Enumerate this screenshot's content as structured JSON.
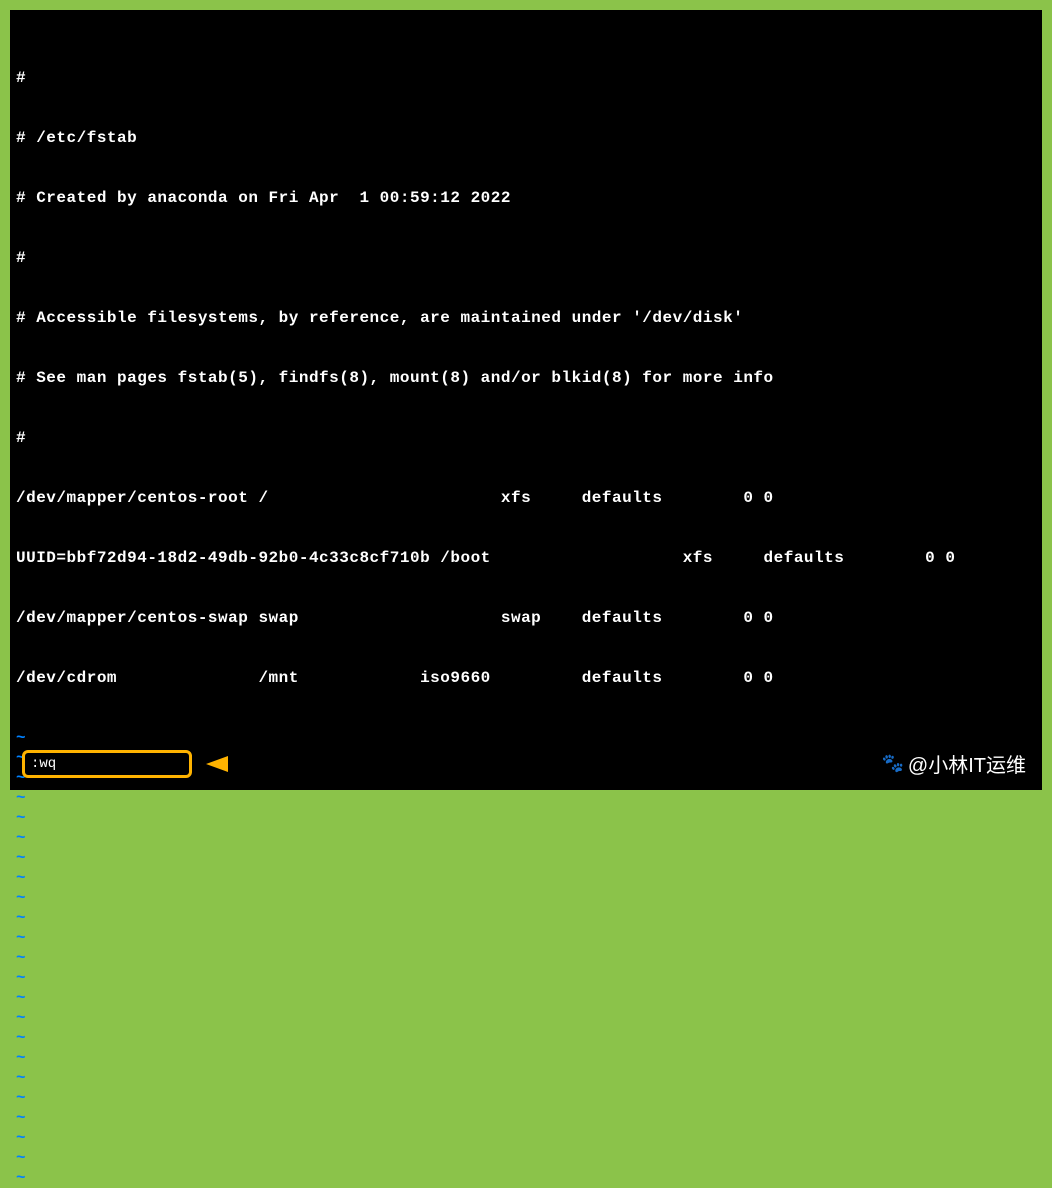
{
  "file_content": {
    "lines": [
      "#",
      "# /etc/fstab",
      "# Created by anaconda on Fri Apr  1 00:59:12 2022",
      "#",
      "# Accessible filesystems, by reference, are maintained under '/dev/disk'",
      "# See man pages fstab(5), findfs(8), mount(8) and/or blkid(8) for more info",
      "#",
      "/dev/mapper/centos-root /                       xfs     defaults        0 0",
      "UUID=bbf72d94-18d2-49db-92b0-4c33c8cf710b /boot                   xfs     defaults        0 0",
      "/dev/mapper/centos-swap swap                    swap    defaults        0 0",
      "/dev/cdrom              /mnt            iso9660         defaults        0 0"
    ]
  },
  "tilde_count": 23,
  "tilde_char": "~",
  "command": ":wq",
  "watermark": {
    "icon": "🐾",
    "text": "@小林IT运维"
  }
}
